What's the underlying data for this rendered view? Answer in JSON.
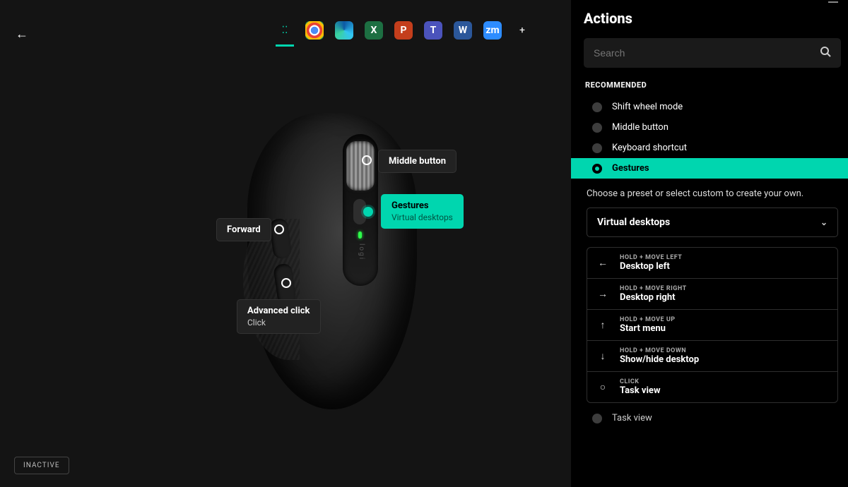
{
  "appbar": {
    "apps": [
      "Chrome",
      "Edge",
      "Excel",
      "PowerPoint",
      "Teams",
      "Word",
      "Zoom"
    ]
  },
  "mouse": {
    "brand": "logi",
    "callouts": {
      "middle": {
        "title": "Middle button"
      },
      "gesture": {
        "title": "Gestures",
        "sub": "Virtual desktops"
      },
      "forward": {
        "title": "Forward"
      },
      "advanced": {
        "title": "Advanced click",
        "sub": "Click"
      }
    }
  },
  "status": {
    "inactive": "INACTIVE"
  },
  "panel": {
    "title": "Actions",
    "search_placeholder": "Search",
    "recommended_label": "RECOMMENDED",
    "recommended": [
      "Shift wheel mode",
      "Middle button",
      "Keyboard shortcut",
      "Gestures"
    ],
    "selected_index": 3,
    "preset_hint": "Choose a preset or select custom to create your own.",
    "preset_value": "Virtual desktops",
    "gestures": [
      {
        "dir": "←",
        "trigger": "HOLD + MOVE LEFT",
        "action": "Desktop left"
      },
      {
        "dir": "→",
        "trigger": "HOLD + MOVE RIGHT",
        "action": "Desktop right"
      },
      {
        "dir": "↑",
        "trigger": "HOLD + MOVE UP",
        "action": "Start menu"
      },
      {
        "dir": "↓",
        "trigger": "HOLD + MOVE DOWN",
        "action": "Show/hide desktop"
      },
      {
        "dir": "○",
        "trigger": "CLICK",
        "action": "Task view"
      }
    ],
    "more_below": "Task view"
  }
}
